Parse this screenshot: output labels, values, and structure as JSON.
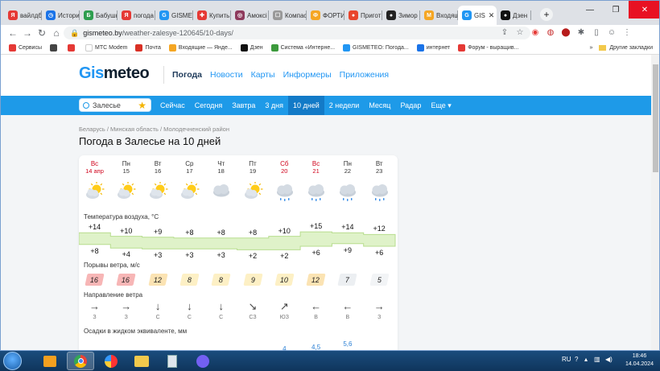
{
  "browser": {
    "tabs": [
      {
        "label": "вайлдб",
        "fav": "Я",
        "color": "#e53935"
      },
      {
        "label": "Истори",
        "fav": "◷",
        "color": "#1a73e8"
      },
      {
        "label": "Бабушк",
        "fav": "Б",
        "color": "#2e9e4f"
      },
      {
        "label": "погода",
        "fav": "Я",
        "color": "#e53935"
      },
      {
        "label": "GISMETE",
        "fav": "G",
        "color": "#2196f3"
      },
      {
        "label": "Купить",
        "fav": "✚",
        "color": "#e53935"
      },
      {
        "label": "Амоксі",
        "fav": "◎",
        "color": "#8e3a5c"
      },
      {
        "label": "Компас",
        "fav": "☐",
        "color": "#999999"
      },
      {
        "label": "ФОРТИ",
        "fav": "Ф",
        "color": "#f5a623"
      },
      {
        "label": "Пригот",
        "fav": "●",
        "color": "#e8452c"
      },
      {
        "label": "Зимор",
        "fav": "●",
        "color": "#222222"
      },
      {
        "label": "Входящ",
        "fav": "M",
        "color": "#f5a623"
      },
      {
        "label": "GIS",
        "fav": "G",
        "color": "#2196f3",
        "active": true
      },
      {
        "label": "Дзен",
        "fav": "●",
        "color": "#111111"
      }
    ],
    "url_prefix": "gismeteo.by",
    "url_path": "/weather-zalesye-120645/10-days/",
    "bookmarks": [
      {
        "label": "Сервисы",
        "color": "#e53935"
      },
      {
        "label": "",
        "color": "#444444"
      },
      {
        "label": "",
        "color": "#e53935"
      },
      {
        "label": "МТС Modem",
        "color": "#ffffff"
      },
      {
        "label": "Почта",
        "color": "#d93025"
      },
      {
        "label": "Входящие — Янде...",
        "color": "#f5a623"
      },
      {
        "label": "Дзен",
        "color": "#111111"
      },
      {
        "label": "Система «Интерне...",
        "color": "#3c9a3c"
      },
      {
        "label": "GISMETEO: Погода...",
        "color": "#2196f3"
      },
      {
        "label": "интернет",
        "color": "#1a73e8"
      },
      {
        "label": "Форум - выращив...",
        "color": "#e53935"
      }
    ],
    "bookmarks_more": "»",
    "other_bookmarks": "Другие закладки"
  },
  "site": {
    "logo_a": "Gis",
    "logo_b": "meteo",
    "menu": [
      "Погода",
      "Новости",
      "Карты",
      "Информеры",
      "Приложения"
    ],
    "search_placeholder": "Залесье",
    "nav": [
      "Сейчас",
      "Сегодня",
      "Завтра",
      "3 дня",
      "10 дней",
      "2 недели",
      "Месяц",
      "Радар",
      "Еще"
    ],
    "nav_selected": 4,
    "breadcrumb": "Беларусь / Минская область / Молодечненский район",
    "title": "Погода в Залесье на 10 дней"
  },
  "forecast": {
    "days": [
      {
        "dow": "Вс",
        "date": "14 апр",
        "red": true,
        "icon": "sun-cloud-icon",
        "tmax": "+14",
        "tmin": "+8",
        "gust": "16",
        "dir": "→",
        "dirl": "З",
        "prec": ""
      },
      {
        "dow": "Пн",
        "date": "15",
        "red": false,
        "icon": "sun-cloud-icon",
        "tmax": "+10",
        "tmin": "+4",
        "gust": "16",
        "dir": "→",
        "dirl": "З",
        "prec": ""
      },
      {
        "dow": "Вт",
        "date": "16",
        "red": false,
        "icon": "sun-cloud-icon",
        "tmax": "+9",
        "tmin": "+3",
        "gust": "12",
        "dir": "↓",
        "dirl": "С",
        "prec": ""
      },
      {
        "dow": "Ср",
        "date": "17",
        "red": false,
        "icon": "sun-cloud-icon",
        "tmax": "+8",
        "tmin": "+3",
        "gust": "8",
        "dir": "↓",
        "dirl": "С",
        "prec": ""
      },
      {
        "dow": "Чт",
        "date": "18",
        "red": false,
        "icon": "cloud-icon",
        "tmax": "+8",
        "tmin": "+3",
        "gust": "8",
        "dir": "↓",
        "dirl": "С",
        "prec": ""
      },
      {
        "dow": "Пт",
        "date": "19",
        "red": false,
        "icon": "sun-cloud-icon",
        "tmax": "+8",
        "tmin": "+2",
        "gust": "9",
        "dir": "↘",
        "dirl": "СЗ",
        "prec": ""
      },
      {
        "dow": "Сб",
        "date": "20",
        "red": true,
        "icon": "cloud-rain-icon",
        "tmax": "+10",
        "tmin": "+2",
        "gust": "10",
        "dir": "↗",
        "dirl": "ЮЗ",
        "prec": "4"
      },
      {
        "dow": "Вс",
        "date": "21",
        "red": true,
        "icon": "cloud-rain-icon",
        "tmax": "+15",
        "tmin": "+6",
        "gust": "12",
        "dir": "←",
        "dirl": "В",
        "prec": "4,5"
      },
      {
        "dow": "Пн",
        "date": "22",
        "red": false,
        "icon": "cloud-rain-icon",
        "tmax": "+14",
        "tmin": "+9",
        "gust": "7",
        "dir": "←",
        "dirl": "В",
        "prec": "5,6"
      },
      {
        "dow": "Вт",
        "date": "23",
        "red": false,
        "icon": "cloud-rain-icon",
        "tmax": "+12",
        "tmin": "+6",
        "gust": "5",
        "dir": "→",
        "dirl": "З",
        "prec": ""
      }
    ],
    "label_temp": "Температура воздуха, °C",
    "label_gust": "Порывы ветра, м/с",
    "label_dir": "Направление ветра",
    "label_prec": "Осадки в жидком эквиваленте, мм"
  },
  "taskbar": {
    "lang": "RU",
    "time": "18:46",
    "date": "14.04.2024"
  }
}
